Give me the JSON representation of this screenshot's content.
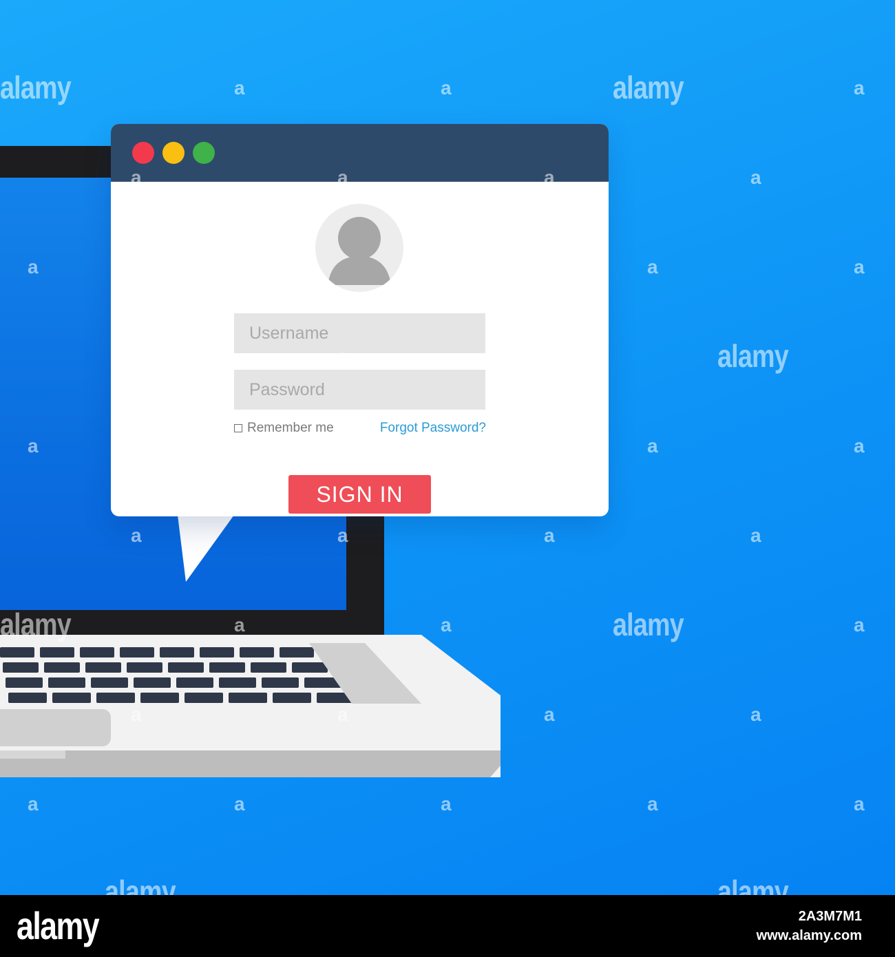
{
  "colors": {
    "background": "#0d93f6",
    "titlebar": "#2e4a6b",
    "sign_in_button": "#ef4d57",
    "link": "#2a9bd4",
    "field": "#e5e5e5",
    "window_close": "#f23a4c",
    "window_minimize": "#fbbf12",
    "window_maximize": "#3fb24a"
  },
  "login": {
    "avatar_icon": "user-silhouette-icon",
    "username_placeholder": "Username",
    "password_placeholder": "Password",
    "remember_label": "Remember me",
    "forgot_label": "Forgot Password?",
    "sign_in_label": "SIGN IN"
  },
  "watermark": {
    "word": "alamy",
    "letter": "a"
  },
  "footer": {
    "logo": "alamy",
    "image_id": "2A3M7M1",
    "url": "www.alamy.com"
  }
}
